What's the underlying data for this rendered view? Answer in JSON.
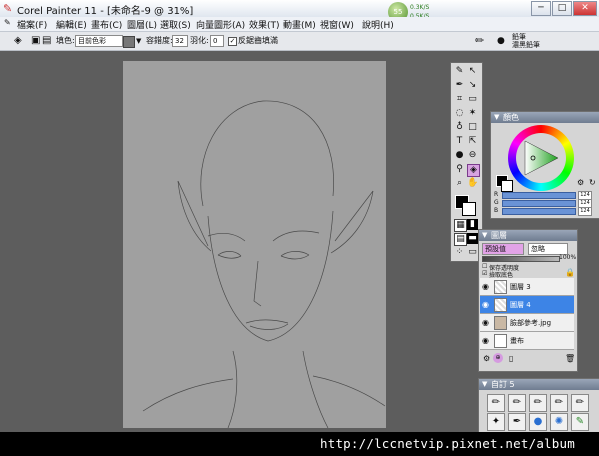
{
  "window": {
    "app_title": "Corel Painter 11 - [未命名-9 @ 31%]"
  },
  "network": {
    "upload": "0.3K/S",
    "download": "0.5K/S",
    "percent": "55"
  },
  "menu": [
    "檔案(F)",
    "編輯(E)",
    "畫布(C)",
    "圖層(L)",
    "選取(S)",
    "向量圖形(A)",
    "效果(T)",
    "動畫(M)",
    "視窗(W)",
    "說明(H)"
  ],
  "toolbar": {
    "fill_label": "填色:",
    "fill_value": "目前色彩",
    "tolerance_label": "容錯度:",
    "tolerance_value": "32",
    "feather_label": "羽化:",
    "feather_value": "0",
    "antialias_label": "反鋸齒填滿",
    "brush_category": "鉛筆",
    "brush_variant": "濃黑鉛筆"
  },
  "color_panel": {
    "title": "顏色",
    "rgb": [
      {
        "label": "R",
        "value": "124"
      },
      {
        "label": "G",
        "value": "124"
      },
      {
        "label": "B",
        "value": "124"
      }
    ]
  },
  "layers_panel": {
    "title": "圖層",
    "composite_method": "預設值",
    "composite_depth": "忽略",
    "opacity": "100%",
    "preserve_transparency": "保存透明度",
    "pick_up_underlying": "撿取底色",
    "layers": [
      {
        "name": "圖層 3",
        "selected": false
      },
      {
        "name": "圖層 4",
        "selected": true
      },
      {
        "name": "臉部參考.jpg",
        "selected": false
      },
      {
        "name": "畫布",
        "selected": false
      }
    ]
  },
  "custom_palette": {
    "title": "自訂 5"
  },
  "watermark": "http://lccnetvip.pixnet.net/album"
}
